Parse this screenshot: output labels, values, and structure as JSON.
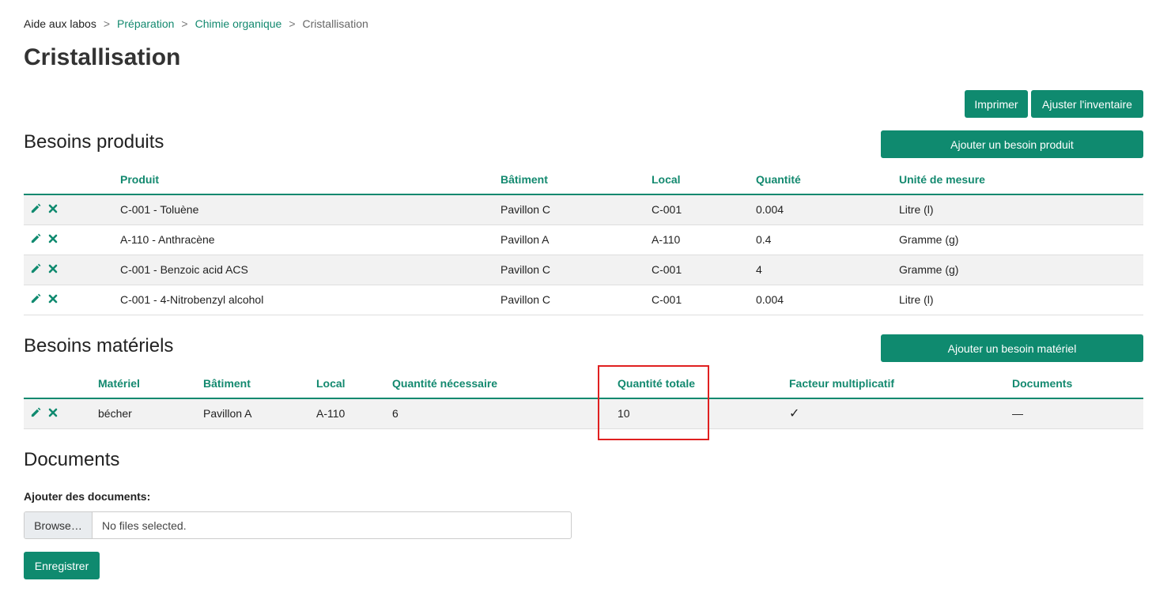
{
  "breadcrumb": {
    "root": "Aide aux labos",
    "level1": "Préparation",
    "level2": "Chimie organique",
    "current": "Cristallisation",
    "separator": ">"
  },
  "page_title": "Cristallisation",
  "toolbar": {
    "print_label": "Imprimer",
    "adjust_inventory_label": "Ajuster l'inventaire"
  },
  "products": {
    "title": "Besoins produits",
    "add_label": "Ajouter un besoin produit",
    "columns": [
      "Produit",
      "Bâtiment",
      "Local",
      "Quantité",
      "Unité de mesure"
    ],
    "rows": [
      [
        "C-001 - Toluène",
        "Pavillon C",
        "C-001",
        "0.004",
        "Litre (l)"
      ],
      [
        "A-110 - Anthracène",
        "Pavillon A",
        "A-110",
        "0.4",
        "Gramme (g)"
      ],
      [
        "C-001 - Benzoic acid ACS",
        "Pavillon C",
        "C-001",
        "4",
        "Gramme (g)"
      ],
      [
        "C-001 - 4-Nitrobenzyl alcohol",
        "Pavillon C",
        "C-001",
        "0.004",
        "Litre (l)"
      ]
    ]
  },
  "materials": {
    "title": "Besoins matériels",
    "add_label": "Ajouter un besoin matériel",
    "columns": [
      "Matériel",
      "Bâtiment",
      "Local",
      "Quantité nécessaire",
      "Quantité totale",
      "Facteur multiplicatif",
      "Documents"
    ],
    "rows": [
      [
        "bécher",
        "Pavillon A",
        "A-110",
        "6",
        "10",
        "✓",
        "—"
      ]
    ]
  },
  "documents": {
    "title": "Documents",
    "add_label": "Ajouter des documents:",
    "browse_label": "Browse…",
    "file_status": "No files selected.",
    "save_label": "Enregistrer"
  },
  "colors": {
    "accent": "#0f8a6f",
    "highlight": "#e02020"
  }
}
